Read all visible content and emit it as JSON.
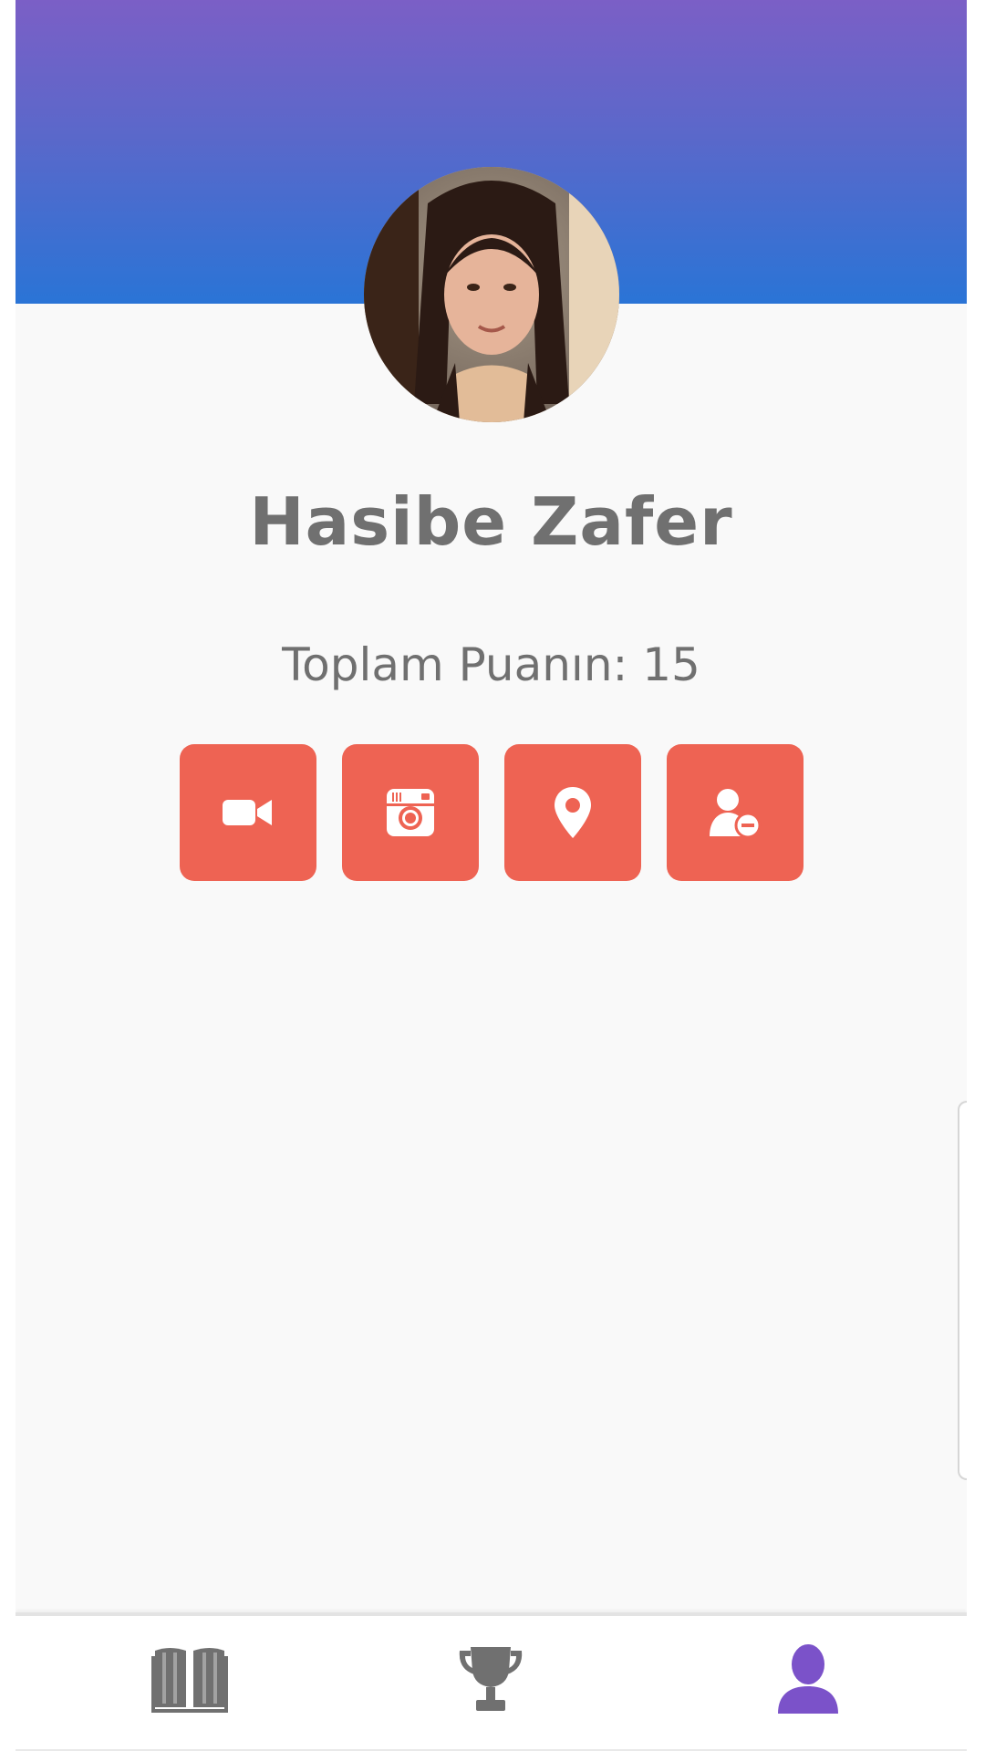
{
  "profile": {
    "name": "Hasibe Zafer",
    "score_text": "Toplam Puanın: 15"
  },
  "actions": [
    {
      "icon": "video-camera-icon"
    },
    {
      "icon": "instagram-icon"
    },
    {
      "icon": "location-pin-icon"
    },
    {
      "icon": "remove-user-icon"
    }
  ],
  "bottom_nav": [
    {
      "icon": "book-icon",
      "active": false
    },
    {
      "icon": "trophy-icon",
      "active": false
    },
    {
      "icon": "user-icon",
      "active": true
    }
  ],
  "colors": {
    "header_gradient_top": "#7b5fc6",
    "header_gradient_bottom": "#2a74d6",
    "action_button": "#ee6353",
    "nav_inactive": "#707070",
    "nav_active": "#7b52c9",
    "text": "#707070"
  }
}
